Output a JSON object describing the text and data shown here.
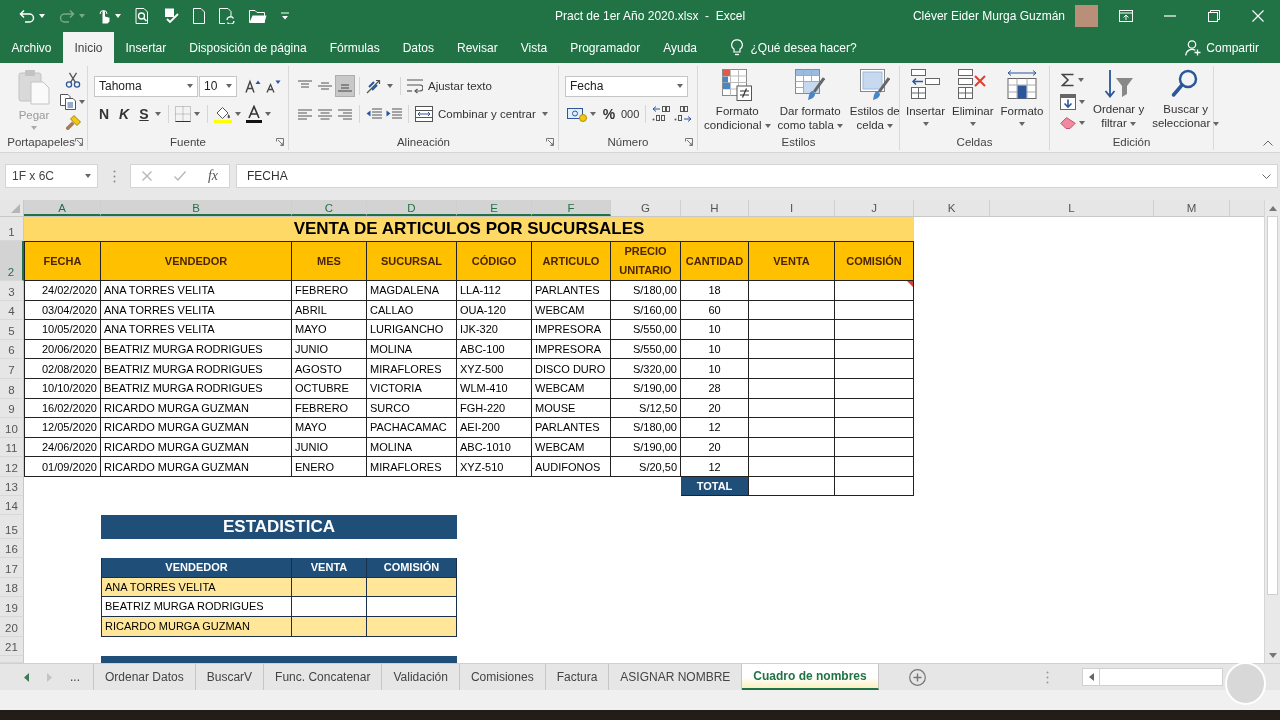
{
  "title_bar": {
    "file_title": "Pract de 1er Año 2020.xlsx  -  Excel",
    "user_name": "Cléver Eider Murga Guzmán"
  },
  "menu_tabs": [
    {
      "label": "Archivo",
      "selected": false
    },
    {
      "label": "Inicio",
      "selected": true
    },
    {
      "label": "Insertar",
      "selected": false
    },
    {
      "label": "Disposición de página",
      "selected": false
    },
    {
      "label": "Fórmulas",
      "selected": false
    },
    {
      "label": "Datos",
      "selected": false
    },
    {
      "label": "Revisar",
      "selected": false
    },
    {
      "label": "Vista",
      "selected": false
    },
    {
      "label": "Programador",
      "selected": false
    },
    {
      "label": "Ayuda",
      "selected": false
    }
  ],
  "tell_me": "¿Qué desea hacer?",
  "share": "Compartir",
  "ribbon": [
    {
      "kind": "clipboard",
      "label": "Portapapeles",
      "paste": "Pegar"
    },
    {
      "kind": "font",
      "label": "Fuente",
      "font": "Tahoma",
      "size": "10",
      "bold": "N",
      "italic": "K",
      "underline": "S"
    },
    {
      "kind": "alignment",
      "label": "Alineación",
      "valign": [
        {
          "selected": false
        },
        {
          "selected": false
        },
        {
          "selected": true
        }
      ],
      "wrap": "Ajustar texto",
      "merge": "Combinar y centrar"
    },
    {
      "kind": "number",
      "label": "Número",
      "format": "Fecha",
      "percent": "%",
      "thousands": "000"
    },
    {
      "kind": "styles",
      "label": "Estilos",
      "buttons": [
        "Formato\ncondicional",
        "Dar formato\ncomo tabla",
        "Estilos de\ncelda"
      ]
    },
    {
      "kind": "cells",
      "label": "Celdas",
      "buttons": [
        "Insertar",
        "Eliminar",
        "Formato"
      ]
    },
    {
      "kind": "editing",
      "label": "Edición",
      "buttons": [
        "Ordenar y\nfiltrar",
        "Buscar y\nseleccionar"
      ]
    }
  ],
  "formula_bar": {
    "name_box": "1F x 6C",
    "function_label": "fx",
    "formula": "FECHA"
  },
  "sheet": {
    "columns": [
      {
        "label": "A",
        "selected": true
      },
      {
        "label": "B",
        "selected": true
      },
      {
        "label": "C",
        "selected": true
      },
      {
        "label": "D",
        "selected": true
      },
      {
        "label": "E",
        "selected": true
      },
      {
        "label": "F",
        "selected": true
      },
      {
        "label": "G",
        "selected": false
      },
      {
        "label": "H",
        "selected": false
      },
      {
        "label": "I",
        "selected": false
      },
      {
        "label": "J",
        "selected": false
      },
      {
        "label": "K",
        "selected": false
      },
      {
        "label": "L",
        "selected": false
      },
      {
        "label": "M",
        "selected": false
      }
    ],
    "row_headers": [
      {
        "label": "1",
        "selected": false
      },
      {
        "label": "2",
        "selected": true
      },
      {
        "label": "3",
        "selected": false
      },
      {
        "label": "4",
        "selected": false
      },
      {
        "label": "5",
        "selected": false
      },
      {
        "label": "6",
        "selected": false
      },
      {
        "label": "7",
        "selected": false
      },
      {
        "label": "8",
        "selected": false
      },
      {
        "label": "9",
        "selected": false
      },
      {
        "label": "10",
        "selected": false
      },
      {
        "label": "11",
        "selected": false
      },
      {
        "label": "12",
        "selected": false
      },
      {
        "label": "13",
        "selected": false
      },
      {
        "label": "14",
        "selected": false
      },
      {
        "label": "15",
        "selected": false
      },
      {
        "label": "16",
        "selected": false
      },
      {
        "label": "17",
        "selected": false
      },
      {
        "label": "18",
        "selected": false
      },
      {
        "label": "19",
        "selected": false
      },
      {
        "label": "20",
        "selected": false
      },
      {
        "label": "21",
        "selected": false
      }
    ],
    "sales_table": {
      "title": "VENTA DE ARTICULOS POR SUCURSALES",
      "headers": [
        "FECHA",
        "VENDEDOR",
        "MES",
        "SUCURSAL",
        "CÓDIGO",
        "ARTICULO",
        "PRECIO UNITARIO",
        "CANTIDAD",
        "VENTA",
        "COMISIÓN"
      ],
      "rows": [
        {
          "cells": [
            "24/02/2020",
            "ANA TORRES VELITA",
            "FEBRERO",
            "MAGDALENA",
            "LLA-112",
            "PARLANTES",
            "S/180,00",
            "18"
          ],
          "has_note": true
        },
        {
          "cells": [
            "03/04/2020",
            "ANA TORRES VELITA",
            "ABRIL",
            "CALLAO",
            "OUA-120",
            "WEBCAM",
            "S/160,00",
            "60"
          ],
          "has_note": false
        },
        {
          "cells": [
            "10/05/2020",
            "ANA TORRES VELITA",
            "MAYO",
            "LURIGANCHO",
            "IJK-320",
            "IMPRESORA",
            "S/550,00",
            "10"
          ],
          "has_note": false
        },
        {
          "cells": [
            "20/06/2020",
            "BEATRIZ MURGA RODRIGUES",
            "JUNIO",
            "MOLINA",
            "ABC-100",
            "IMPRESORA",
            "S/550,00",
            "10"
          ],
          "has_note": false
        },
        {
          "cells": [
            "02/08/2020",
            "BEATRIZ MURGA RODRIGUES",
            "AGOSTO",
            "MIRAFLORES",
            "XYZ-500",
            "DISCO DURO",
            "S/320,00",
            "10"
          ],
          "has_note": false
        },
        {
          "cells": [
            "10/10/2020",
            "BEATRIZ MURGA RODRIGUES",
            "OCTUBRE",
            "VICTORIA",
            "WLM-410",
            "WEBCAM",
            "S/190,00",
            "28"
          ],
          "has_note": false
        },
        {
          "cells": [
            "16/02/2020",
            "RICARDO MURGA GUZMAN",
            "FEBRERO",
            "SURCO",
            "FGH-220",
            "MOUSE",
            "S/12,50",
            "20"
          ],
          "has_note": false
        },
        {
          "cells": [
            "12/05/2020",
            "RICARDO MURGA GUZMAN",
            "MAYO",
            "PACHACAMAC",
            "AEI-200",
            "PARLANTES",
            "S/180,00",
            "12"
          ],
          "has_note": false
        },
        {
          "cells": [
            "24/06/2020",
            "RICARDO MURGA GUZMAN",
            "JUNIO",
            "MOLINA",
            "ABC-1010",
            "WEBCAM",
            "S/190,00",
            "20"
          ],
          "has_note": false
        },
        {
          "cells": [
            "01/09/2020",
            "RICARDO MURGA GUZMAN",
            "ENERO",
            "MIRAFLORES",
            "XYZ-510",
            "AUDIFONOS",
            "S/20,50",
            "12"
          ],
          "has_note": false
        }
      ],
      "total_label": "TOTAL"
    },
    "stats_table": {
      "title": "ESTADISTICA",
      "headers": [
        "VENDEDOR",
        "VENTA",
        "COMISIÓN"
      ],
      "rows": [
        "ANA TORRES VELITA",
        "BEATRIZ MURGA RODRIGUES",
        "RICARDO MURGA GUZMAN"
      ]
    }
  },
  "sheet_tabs_overflow": "...",
  "sheet_tabs": [
    {
      "label": "Ordenar Datos",
      "selected": false
    },
    {
      "label": "BuscarV",
      "selected": false
    },
    {
      "label": "Func. Concatenar",
      "selected": false
    },
    {
      "label": "Validación",
      "selected": false
    },
    {
      "label": "Comisiones",
      "selected": false
    },
    {
      "label": "Factura",
      "selected": false
    },
    {
      "label": "ASIGNAR NOMBRE",
      "selected": false
    },
    {
      "label": "Cuadro de nombres",
      "selected": true
    }
  ]
}
